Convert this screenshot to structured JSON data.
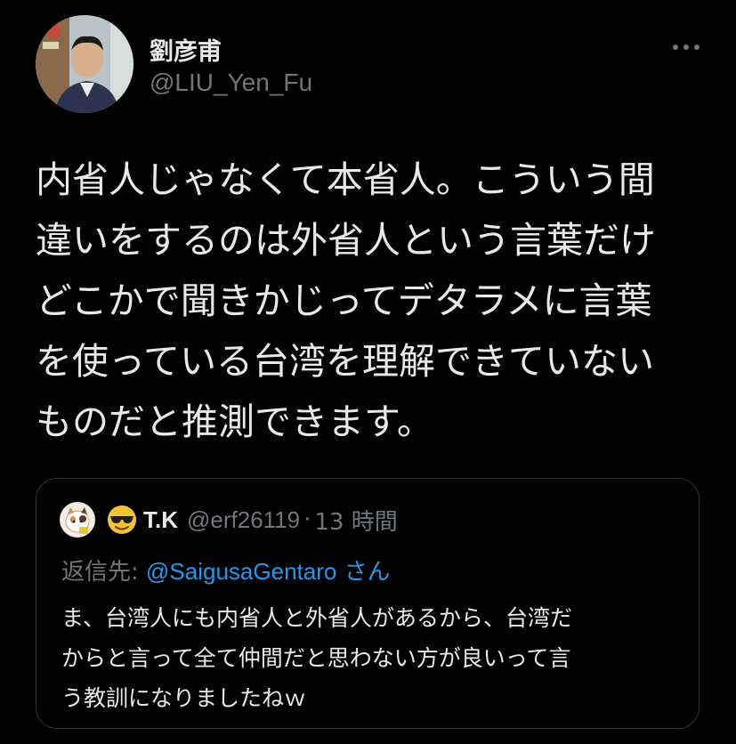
{
  "author": {
    "display_name": "劉彦甫",
    "handle": "@LIU_Yen_Fu"
  },
  "more_icon": "more-horizontal-icon",
  "tweet": {
    "lines": [
      "内省人じゃなくて本省人。こういう間",
      "違いをするのは外省人という言葉だけ",
      "どこかで聞きかじってデタラメに言葉",
      "を使っている台湾を理解できていない",
      "ものだと推測できます。"
    ]
  },
  "quote": {
    "name": "T.K",
    "handle": "@erf26119",
    "separator": "·",
    "time": "13 時間",
    "emoji_icon": "sunglasses-emoji-icon",
    "reply_prefix": "返信先: ",
    "reply_mention": "@SaigusaGentaro",
    "reply_suffix": " さん",
    "lines": [
      "ま、台湾人にも内省人と外省人があるから、台湾だ",
      "からと言って全て仲間だと思わない方が良いって言",
      "う教訓になりましたねｗ"
    ]
  },
  "colors": {
    "background": "#000000",
    "text": "#e7e9ea",
    "secondary": "#71767b",
    "link": "#1d9bf0",
    "border": "#2f3336"
  }
}
